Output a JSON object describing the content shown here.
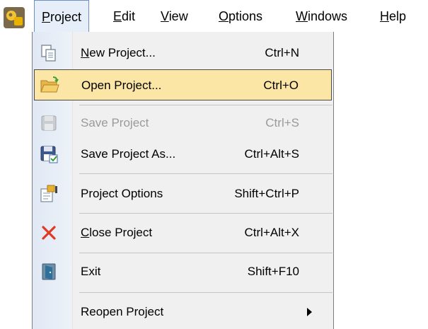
{
  "menubar": {
    "items": [
      {
        "label": "Project",
        "mnemonic": "P",
        "rest": "roject"
      },
      {
        "label": "Edit",
        "mnemonic": "E",
        "rest": "dit"
      },
      {
        "label": "View",
        "mnemonic": "V",
        "rest": "iew"
      },
      {
        "label": "Options",
        "mnemonic": "O",
        "rest": "ptions"
      },
      {
        "label": "Windows",
        "mnemonic": "W",
        "rest": "indows"
      },
      {
        "label": "Help",
        "mnemonic": "H",
        "rest": "elp"
      }
    ]
  },
  "menu": {
    "new_project": {
      "mnemonic": "N",
      "rest": "ew Project...",
      "shortcut": "Ctrl+N"
    },
    "open_project": {
      "label": "Open Project...",
      "shortcut": "Ctrl+O"
    },
    "save_project": {
      "label": "Save Project",
      "shortcut": "Ctrl+S"
    },
    "save_as": {
      "label": "Save Project As...",
      "shortcut": "Ctrl+Alt+S"
    },
    "options": {
      "label": "Project Options",
      "shortcut": "Shift+Ctrl+P"
    },
    "close_project": {
      "mnemonic": "C",
      "rest": "lose Project",
      "shortcut": "Ctrl+Alt+X"
    },
    "exit": {
      "label": "Exit",
      "shortcut": "Shift+F10"
    },
    "reopen": {
      "label": "Reopen Project"
    }
  },
  "colors": {
    "highlight": "#fbe6a6",
    "active_menu": "#e6eef9",
    "disabled_text": "#9a9a9a",
    "close_icon": "#e03a22"
  }
}
